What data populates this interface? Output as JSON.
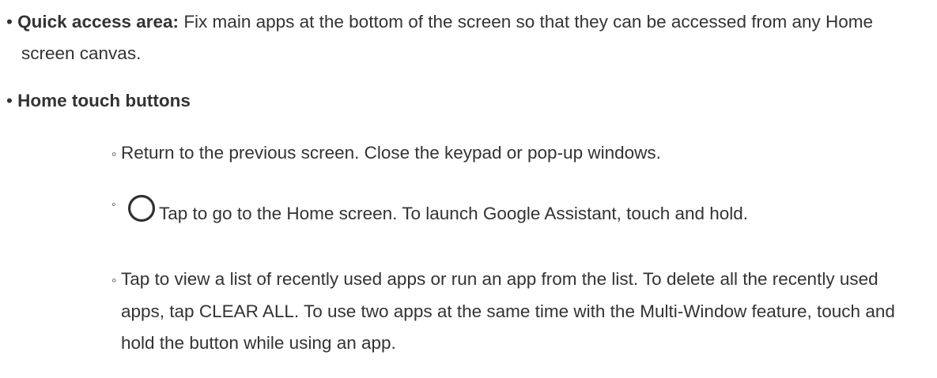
{
  "items": [
    {
      "marker": "•",
      "title": "Quick access area:",
      "text": " Fix main apps at the bottom of the screen so that they can be accessed from any Home screen canvas."
    },
    {
      "marker": "•",
      "title": "Home touch buttons",
      "subitems": [
        {
          "marker": "◦",
          "text": "Return to the previous screen. Close the keypad or pop-up windows."
        },
        {
          "marker": "◦",
          "icon": "home-circle-icon",
          "text": "Tap to go to the Home screen. To launch Google Assistant, touch and hold."
        },
        {
          "marker": "◦",
          "text": "Tap to view a list of recently used apps or run an app from the list. To delete all the recently used apps, tap CLEAR ALL. To use two apps at the same time with the Multi-Window feature, touch and hold the button while using an app."
        }
      ]
    }
  ]
}
